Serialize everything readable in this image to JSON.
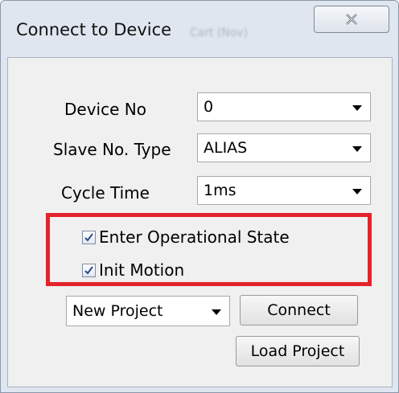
{
  "window": {
    "title": "Connect to Device",
    "background_hint": "Cart (Nov)"
  },
  "form": {
    "device_no": {
      "label": "Device No",
      "value": "0"
    },
    "slave_no_type": {
      "label": "Slave No. Type",
      "value": "ALIAS"
    },
    "cycle_time": {
      "label": "Cycle Time",
      "value": "1ms"
    }
  },
  "options": {
    "enter_operational_state": {
      "label": "Enter Operational State",
      "checked": true
    },
    "init_motion": {
      "label": "Init Motion",
      "checked": true
    },
    "highlight_color": "#e3232a"
  },
  "project": {
    "selected": "New Project",
    "connect_label": "Connect",
    "load_label": "Load Project"
  }
}
